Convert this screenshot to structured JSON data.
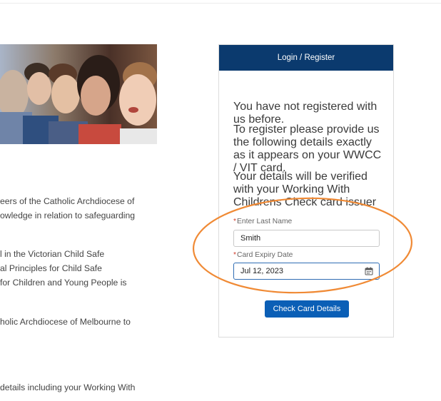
{
  "body_text": [
    "eers of the Catholic Archdiocese of",
    "owledge in relation to safeguarding",
    "l in the Victorian Child Safe",
    "al Principles for Child Safe",
    "for Children and Young People is",
    "holic Archdiocese of Melbourne to",
    "details including your Working With"
  ],
  "login": {
    "title": "Login / Register",
    "para1": "You have not registered with us before.",
    "para2": "To register please provide us the following details exactly as it appears on your WWCC / VIT card.",
    "para3": "Your details will be verified with your Working With Childrens Check card issuer",
    "last_name_label": "Enter Last Name",
    "last_name_value": "Smith",
    "expiry_label": "Card Expiry Date",
    "expiry_value": "Jul 12, 2023",
    "required_mark": "*",
    "button_label": "Check Card Details"
  },
  "colors": {
    "header_bg": "#0b3a6e",
    "button_bg": "#0b5fb6",
    "highlight": "#f08a35",
    "required": "#d13b2b"
  }
}
